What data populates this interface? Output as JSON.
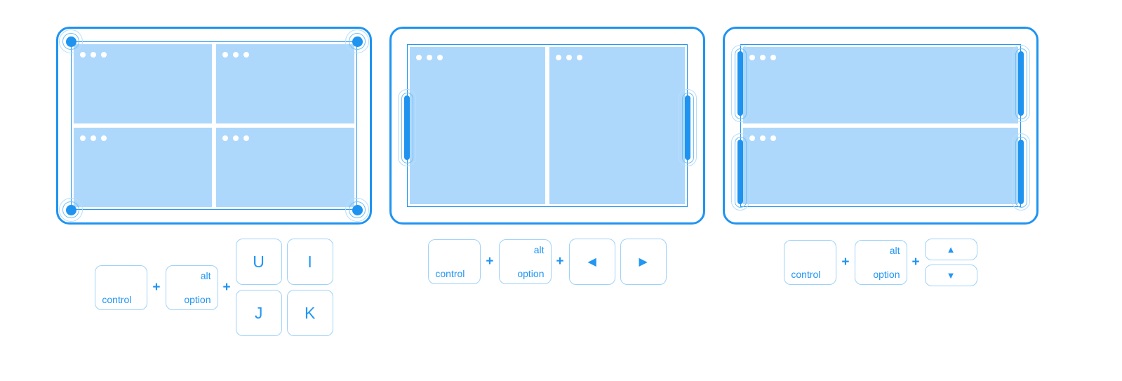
{
  "accent": {
    "bezel": "#1f93f0",
    "frame": "#2196f3",
    "window_fill": "#aed8fb",
    "key_border": "#9fd2f8",
    "key_text": "#2196f3",
    "ring_outer": "#b6ddfb",
    "ring_inner": "#6fc0f7",
    "background": "#ffffff"
  },
  "plus": "+",
  "panels": [
    {
      "name": "quadrant-layout",
      "layout": "quad",
      "windows": [
        {
          "dots": 3
        },
        {
          "dots": 3
        },
        {
          "dots": 3
        },
        {
          "dots": 3
        }
      ],
      "handles": [
        {
          "type": "circle",
          "position": "top-left"
        },
        {
          "type": "circle",
          "position": "top-right"
        },
        {
          "type": "circle",
          "position": "bottom-left"
        },
        {
          "type": "circle",
          "position": "bottom-right"
        }
      ],
      "shortcut": {
        "modifiers": [
          {
            "label_bottom_left": "control"
          },
          {
            "label_top_right": "alt",
            "label_bottom_right": "option"
          }
        ],
        "keys_layout": "grid-2x2",
        "keys": [
          "U",
          "I",
          "J",
          "K"
        ]
      }
    },
    {
      "name": "vertical-split-layout",
      "layout": "vsplit",
      "windows": [
        {
          "dots": 3
        },
        {
          "dots": 3
        }
      ],
      "handles": [
        {
          "type": "pill",
          "position": "left-middle"
        },
        {
          "type": "pill",
          "position": "right-middle"
        }
      ],
      "shortcut": {
        "modifiers": [
          {
            "label_bottom_left": "control"
          },
          {
            "label_top_right": "alt",
            "label_bottom_right": "option"
          }
        ],
        "keys_layout": "row",
        "keys": [
          "◀",
          "▶"
        ]
      }
    },
    {
      "name": "horizontal-split-layout",
      "layout": "hsplit",
      "windows": [
        {
          "dots": 3
        },
        {
          "dots": 3
        }
      ],
      "handles": [
        {
          "type": "pill",
          "position": "left-top"
        },
        {
          "type": "pill",
          "position": "right-top"
        },
        {
          "type": "pill",
          "position": "left-bottom"
        },
        {
          "type": "pill",
          "position": "right-bottom"
        }
      ],
      "shortcut": {
        "modifiers": [
          {
            "label_bottom_left": "control"
          },
          {
            "label_top_right": "alt",
            "label_bottom_right": "option"
          }
        ],
        "keys_layout": "stack",
        "keys": [
          "▲",
          "▼"
        ]
      }
    }
  ]
}
